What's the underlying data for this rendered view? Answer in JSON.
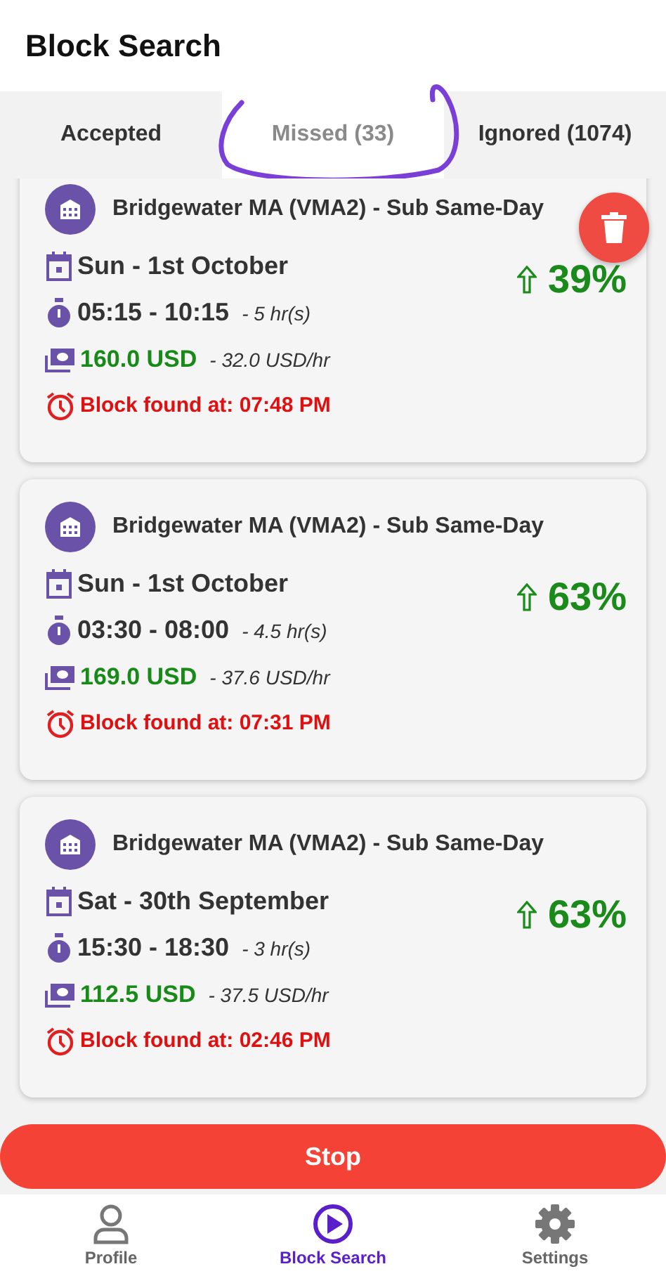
{
  "header": {
    "title": "Block Search"
  },
  "tabs": [
    {
      "label": "Accepted",
      "selected": false
    },
    {
      "label": "Missed (33)",
      "selected": true
    },
    {
      "label": "Ignored (1074)",
      "selected": false
    }
  ],
  "blocks": [
    {
      "title": "Bridgewater MA (VMA2) - Sub Same-Day",
      "date": "Sun - 1st October",
      "time": "05:15 - 10:15",
      "duration": "- 5 hr(s)",
      "price": "160.0 USD",
      "rate": "- 32.0 USD/hr",
      "found": "Block found at: 07:48 PM",
      "change": "39%"
    },
    {
      "title": "Bridgewater MA (VMA2) - Sub Same-Day",
      "date": "Sun - 1st October",
      "time": "03:30 - 08:00",
      "duration": "- 4.5 hr(s)",
      "price": "169.0 USD",
      "rate": "- 37.6 USD/hr",
      "found": "Block found at: 07:31 PM",
      "change": "63%"
    },
    {
      "title": "Bridgewater MA (VMA2) - Sub Same-Day",
      "date": "Sat - 30th September",
      "time": "15:30 - 18:30",
      "duration": "- 3 hr(s)",
      "price": "112.5 USD",
      "rate": "- 37.5 USD/hr",
      "found": "Block found at: 02:46 PM",
      "change": "63%"
    }
  ],
  "stop_button": "Stop",
  "nav": [
    {
      "kind": "profile",
      "label": "Profile",
      "selected": false
    },
    {
      "kind": "search",
      "label": "Block Search",
      "selected": true
    },
    {
      "kind": "settings",
      "label": "Settings",
      "selected": false
    }
  ]
}
